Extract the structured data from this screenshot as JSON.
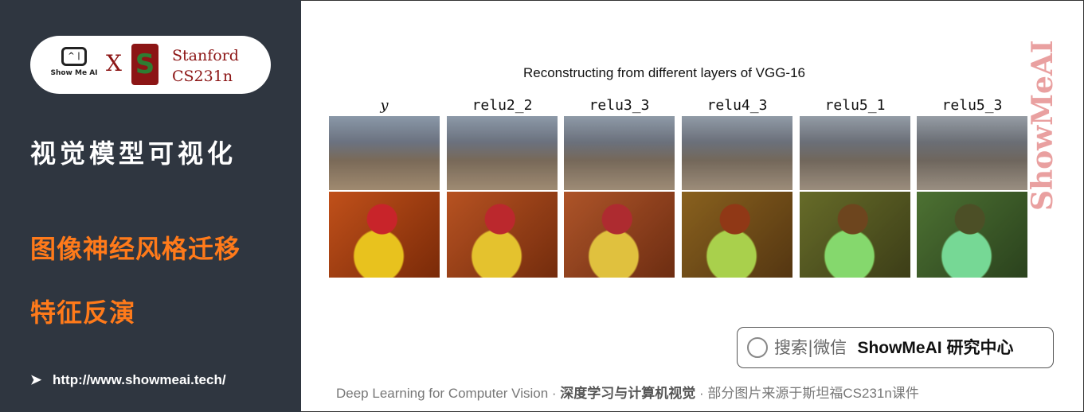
{
  "sidebar": {
    "logo": {
      "showmeai": "Show Me AI",
      "x": "X",
      "stanford": "Stanford",
      "course": "CS231n"
    },
    "title": "视觉模型可视化",
    "topics": [
      "图像神经风格迁移",
      "特征反演"
    ],
    "url": "http://www.showmeai.tech/"
  },
  "figure": {
    "title": "Reconstructing from different layers of VGG-16",
    "columns": [
      "y",
      "relu2_2",
      "relu3_3",
      "relu4_3",
      "relu5_1",
      "relu5_3"
    ]
  },
  "watermark": "ShowMeAI",
  "search": {
    "prefix": "搜索|微信",
    "name": "ShowMeAI 研究中心",
    "icon": "search-icon"
  },
  "footer": {
    "en": "Deep Learning for Computer Vision",
    "sep": " · ",
    "cn": "深度学习与计算机视觉",
    "note": "部分图片来源于斯坦福CS231n课件"
  }
}
